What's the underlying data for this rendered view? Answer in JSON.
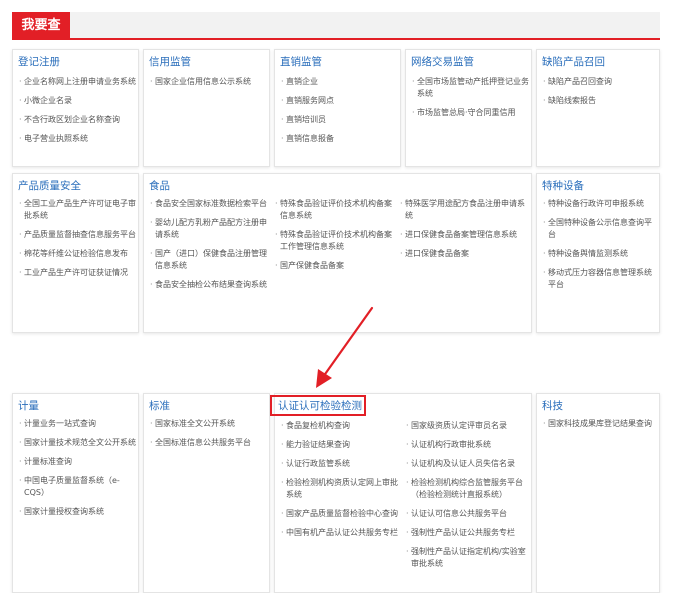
{
  "header": {
    "title": "我要查"
  },
  "sections": {
    "dengji": {
      "title": "登记注册",
      "items": [
        "企业名称网上注册申请业务系统",
        "小微企业名录",
        "不含行政区划企业名称查询",
        "电子营业执照系统"
      ]
    },
    "xinyong": {
      "title": "信用监管",
      "items": [
        "国家企业信用信息公示系统"
      ]
    },
    "zhixiao": {
      "title": "直销监管",
      "items": [
        "直销企业",
        "直销服务网点",
        "直销培训员",
        "直销信息报备"
      ]
    },
    "wangluo": {
      "title": "网络交易监管",
      "items": [
        "全国市场监管动产抵押登记业务系统",
        "市场监管总局·守合同重信用"
      ]
    },
    "quexian": {
      "title": "缺陷产品召回",
      "items": [
        "缺陷产品召回查询",
        "缺陷线索报告"
      ]
    },
    "chanpin": {
      "title": "产品质量安全",
      "items": [
        "全国工业产品生产许可证电子审批系统",
        "产品质量监督抽查信息服务平台",
        "棉花等纤维公证检验信息发布",
        "工业产品生产许可证获证情况"
      ]
    },
    "shipin": {
      "title": "食品",
      "col1": [
        "食品安全国家标准数据检索平台",
        "婴幼儿配方乳粉产品配方注册申请系统",
        "国产（进口）保健食品注册管理信息系统",
        "食品安全抽检公布结果查询系统"
      ],
      "col2": [
        "特殊食品验证评价技术机构备案信息系统",
        "特殊食品验证评价技术机构备案工作管理信息系统",
        "国产保健食品备案"
      ],
      "col3": [
        "特殊医学用途配方食品注册申请系统",
        "进口保健食品备案管理信息系统",
        "进口保健食品备案"
      ]
    },
    "tezhong": {
      "title": "特种设备",
      "items": [
        "特种设备行政许可申报系统",
        "全国特种设备公示信息查询平台",
        "特种设备舆情监测系统",
        "移动式压力容器信息管理系统平台"
      ]
    },
    "jiliang": {
      "title": "计量",
      "items": [
        "计量业务一站式查询",
        "国家计量技术规范全文公开系统",
        "计量标准查询",
        "中国电子质量监督系统（e-CQS）",
        "国家计量授权查询系统"
      ]
    },
    "biaozhun": {
      "title": "标准",
      "items": [
        "国家标准全文公开系统",
        "全国标准信息公共服务平台"
      ]
    },
    "renzheng": {
      "title": "认证认可检验检测",
      "col1": [
        "食品复检机构查询",
        "能力验证结果查询",
        "认证行政监管系统",
        "检验检测机构资质认定网上审批系统",
        "国家产品质量监督检验中心查询",
        "中国有机产品认证公共服务专栏"
      ],
      "col2": [
        "国家级资质认定评审员名录",
        "认证机构行政审批系统",
        "认证机构及认证人员失信名录",
        "检验检测机构综合监管服务平台（检验检测统计直报系统）",
        "认证认可信息公共服务平台",
        "强制性产品认证公共服务专栏",
        "强制性产品认证指定机构/实验室审批系统"
      ]
    },
    "keji": {
      "title": "科技",
      "items": [
        "国家科技成果库登记结果查询"
      ]
    }
  },
  "colors": {
    "accent": "#e21f26",
    "title_blue": "#2a6ebb",
    "text": "#555555"
  },
  "icons": {
    "annotation": "red-arrow-icon"
  }
}
